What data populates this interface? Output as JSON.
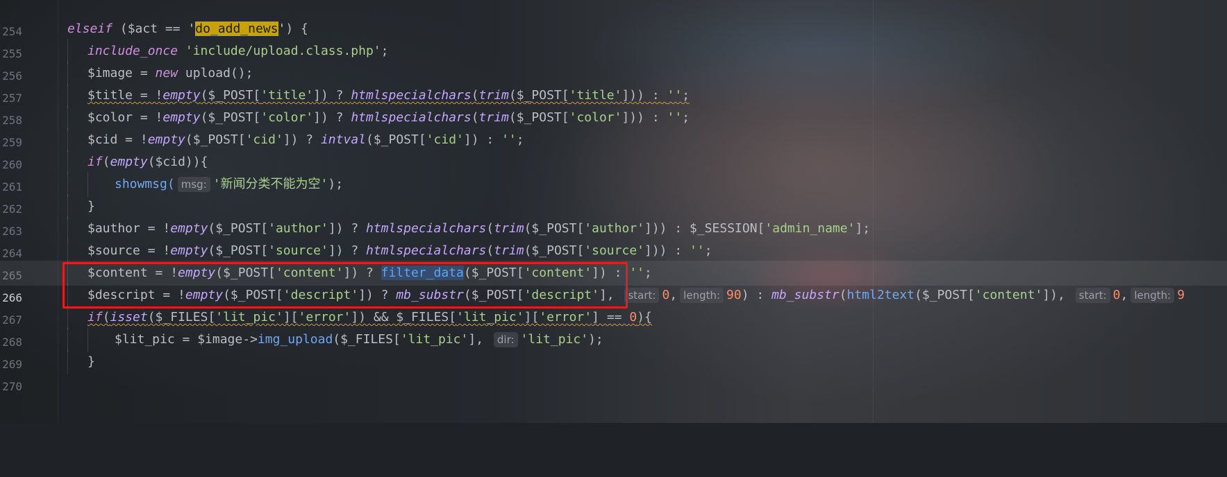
{
  "editor": {
    "lines": [
      {
        "n": "254"
      },
      {
        "n": "255",
        "tokens": {
          "kw": "elseif",
          "p1": " (",
          "v": "$act",
          "op": " == ",
          "q1": "'",
          "hl": "do_add_news",
          "q2": "'",
          "end": ") {"
        }
      },
      {
        "n": "256",
        "tokens": {
          "kw": "include_once",
          "s": " 'include/upload.class.php'",
          "end": ";"
        }
      },
      {
        "n": "257",
        "tokens": {
          "v": "$image",
          "op": " = ",
          "kw": "new",
          "fn": " upload",
          "end": "();"
        }
      },
      {
        "n": "258",
        "text": {
          "a": "$title = !",
          "f1": "empty",
          "b": "($_POST[",
          "s1": "'title'",
          "c": "]) ? ",
          "f2": "htmlspecialchars",
          "d": "(",
          "f3": "trim",
          "e": "($_POST[",
          "s2": "'title'",
          "g": "])) : ",
          "s3": "''",
          "h": ";"
        }
      },
      {
        "n": "259",
        "text": {
          "a": "$color = !",
          "f1": "empty",
          "b": "($_POST[",
          "s1": "'color'",
          "c": "]) ? ",
          "f2": "htmlspecialchars",
          "d": "(",
          "f3": "trim",
          "e": "($_POST[",
          "s2": "'color'",
          "g": "])) : ",
          "s3": "''",
          "h": ";"
        }
      },
      {
        "n": "260",
        "text": {
          "a": "$cid = !",
          "f1": "empty",
          "b": "($_POST[",
          "s1": "'cid'",
          "c": "]) ? ",
          "f2": "intval",
          "e": "($_POST[",
          "s2": "'cid'",
          "g": "]) : ",
          "s3": "''",
          "h": ";"
        }
      },
      {
        "n": "261",
        "text": {
          "kw": "if",
          "a": "(",
          "f1": "empty",
          "b": "($cid)){"
        }
      },
      {
        "n": "262",
        "text": {
          "fn": "showmsg(",
          "hint": "msg:",
          "s": "'新闻分类不能为空'",
          "end": ");"
        }
      },
      {
        "n": "263",
        "text": {
          "a": "}"
        }
      },
      {
        "n": "264",
        "text": {
          "a": "$author = !",
          "f1": "empty",
          "b": "($_POST[",
          "s1": "'author'",
          "c": "]) ? ",
          "f2": "htmlspecialchars",
          "d": "(",
          "f3": "trim",
          "e": "($_POST[",
          "s2": "'author'",
          "g": "])) : $_SESSION[",
          "s3": "'admin_name'",
          "h": "];"
        }
      },
      {
        "n": "265",
        "text": {
          "a": "$source = !",
          "f1": "empty",
          "b": "($_POST[",
          "s1": "'source'",
          "c": "]) ? ",
          "f2": "htmlspecialchars",
          "d": "(",
          "f3": "trim",
          "e": "($_POST[",
          "s2": "'source'",
          "g": "])) : ",
          "s3": "''",
          "h": ";"
        }
      },
      {
        "n": "266",
        "text": {
          "a": "$content = !",
          "f1": "empty",
          "b": "($_POST[",
          "s1": "'content'",
          "c": "]) ? ",
          "f2": "filter_data",
          "e": "($_POST[",
          "s2": "'content'",
          "g": "]) : ",
          "s3": "''",
          "h": ";"
        }
      },
      {
        "n": "267",
        "text": {
          "a": "$descript = !",
          "f1": "empty",
          "b": "($_POST[",
          "s1": "'descript'",
          "c": "]) ? ",
          "f2": "mb_substr",
          "e": "($_POST[",
          "s2": "'descript'",
          "g": "], ",
          "h1": "start:",
          "n1": "0",
          ",": ",",
          "h2": "length:",
          "n2": "90",
          "i": ") : ",
          "f3": "mb_substr",
          "j": "(",
          "f4": "html2text",
          "k": "($_POST[",
          "s3": "'content'",
          "l": "]), ",
          "h3": "start:",
          "n3": "0",
          ",2": ",",
          "h4": "length:",
          "n4": "9"
        }
      },
      {
        "n": "268",
        "text": {
          "kw": "if",
          "a": "(",
          "f1": "isset",
          "b": "($_FILES[",
          "s1": "'lit_pic'",
          "c": "][",
          "s2": "'error'",
          "d": "]) && $_FILES[",
          "s3": "'lit_pic'",
          "e": "][",
          "s4": "'error'",
          "g": "] == ",
          "n1": "0",
          "h": "){"
        }
      },
      {
        "n": "269",
        "text": {
          "a": "$lit_pic = $image->",
          "f1": "img_upload",
          "b": "($_FILES[",
          "s1": "'lit_pic'",
          "c": "], ",
          "hint": "dir:",
          "s2": "'lit_pic'",
          "d": ");"
        }
      },
      {
        "n": "270",
        "text": {
          "a": "}"
        }
      }
    ]
  },
  "colors": {
    "keyword": "#cf8ee0",
    "string": "#a8d08a",
    "number": "#ff8a6a",
    "highlight": "#c8a300",
    "annotation_box": "#e02020"
  }
}
